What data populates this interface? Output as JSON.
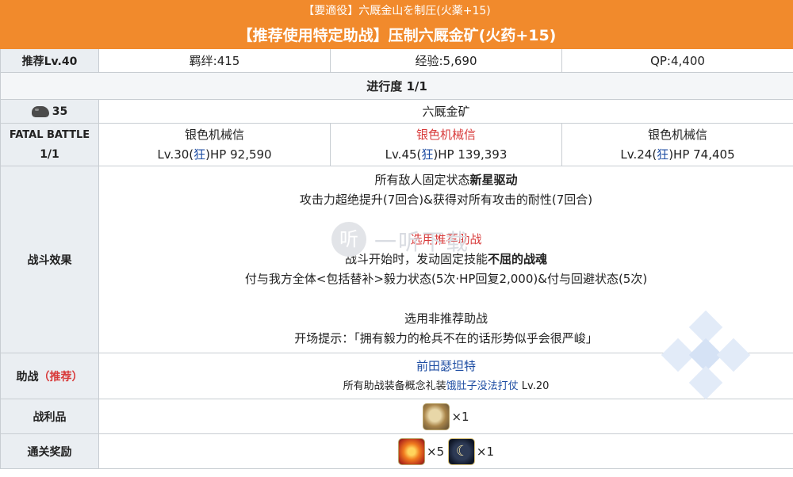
{
  "header": {
    "jp_title": "【要適役】六厩金山を制圧(火薬+15)",
    "cn_title": "【推荐使用特定助战】压制六厩金矿(火药+15)"
  },
  "stats": {
    "recommend_label": "推荐Lv.40",
    "bond": "羁绊:415",
    "exp": "经验:5,690",
    "qp": "QP:4,400"
  },
  "progress": "进行度 1/1",
  "stage": {
    "ap_cost": "35",
    "stage_name": "六厩金矿"
  },
  "fatal_battle": {
    "label_line1": "FATAL BATTLE",
    "label_line2": "1/1",
    "enemies": [
      {
        "name": "银色机械信",
        "level": "Lv.30(",
        "class": "狂",
        "hp": ")HP 92,590"
      },
      {
        "name": "银色机械信",
        "level": "Lv.45(",
        "class": "狂",
        "hp": ")HP 139,393"
      },
      {
        "name": "银色机械信",
        "level": "Lv.24(",
        "class": "狂",
        "hp": ")HP 74,405"
      }
    ]
  },
  "battle_effects": {
    "label": "战斗效果",
    "l1_pre": "所有敌人固定状态",
    "l1_bold": "新星驱动",
    "l2": "攻击力超绝提升(7回合)&获得对所有攻击的耐性(7回合)",
    "l3": "选用推荐助战",
    "l4_pre": "战斗开始时，发动固定技能",
    "l4_bold": "不屈的战魂",
    "l5": "付与我方全体<包括替补>毅力状态(5次·HP回复2,000)&付与回避状态(5次)",
    "l6": "选用非推荐助战",
    "l7": "开场提示：「拥有毅力的枪兵不在的话形势似乎会很严峻」"
  },
  "support": {
    "label": "助战",
    "label_tag": "（推荐）",
    "servant": "前田瑟坦特",
    "ce_pre": "所有助战装备概念礼装",
    "ce_name": "饿肚子没法打仗",
    "ce_level": " Lv.20"
  },
  "drops": {
    "label": "战利品",
    "items": [
      {
        "icon": "shell-material-icon",
        "count": "×1"
      }
    ]
  },
  "rewards": {
    "label": "通关奖励",
    "items": [
      {
        "icon": "fire-gem-icon",
        "count": "×5"
      },
      {
        "icon": "moon-material-icon",
        "count": "×1"
      }
    ]
  },
  "watermark": {
    "text": "一听下载",
    "logo": "听"
  },
  "colors": {
    "header_bg": "#f18a2c",
    "label_bg": "#eaeef2",
    "accent_red": "#d83a3a",
    "accent_blue": "#1f4ea3"
  }
}
